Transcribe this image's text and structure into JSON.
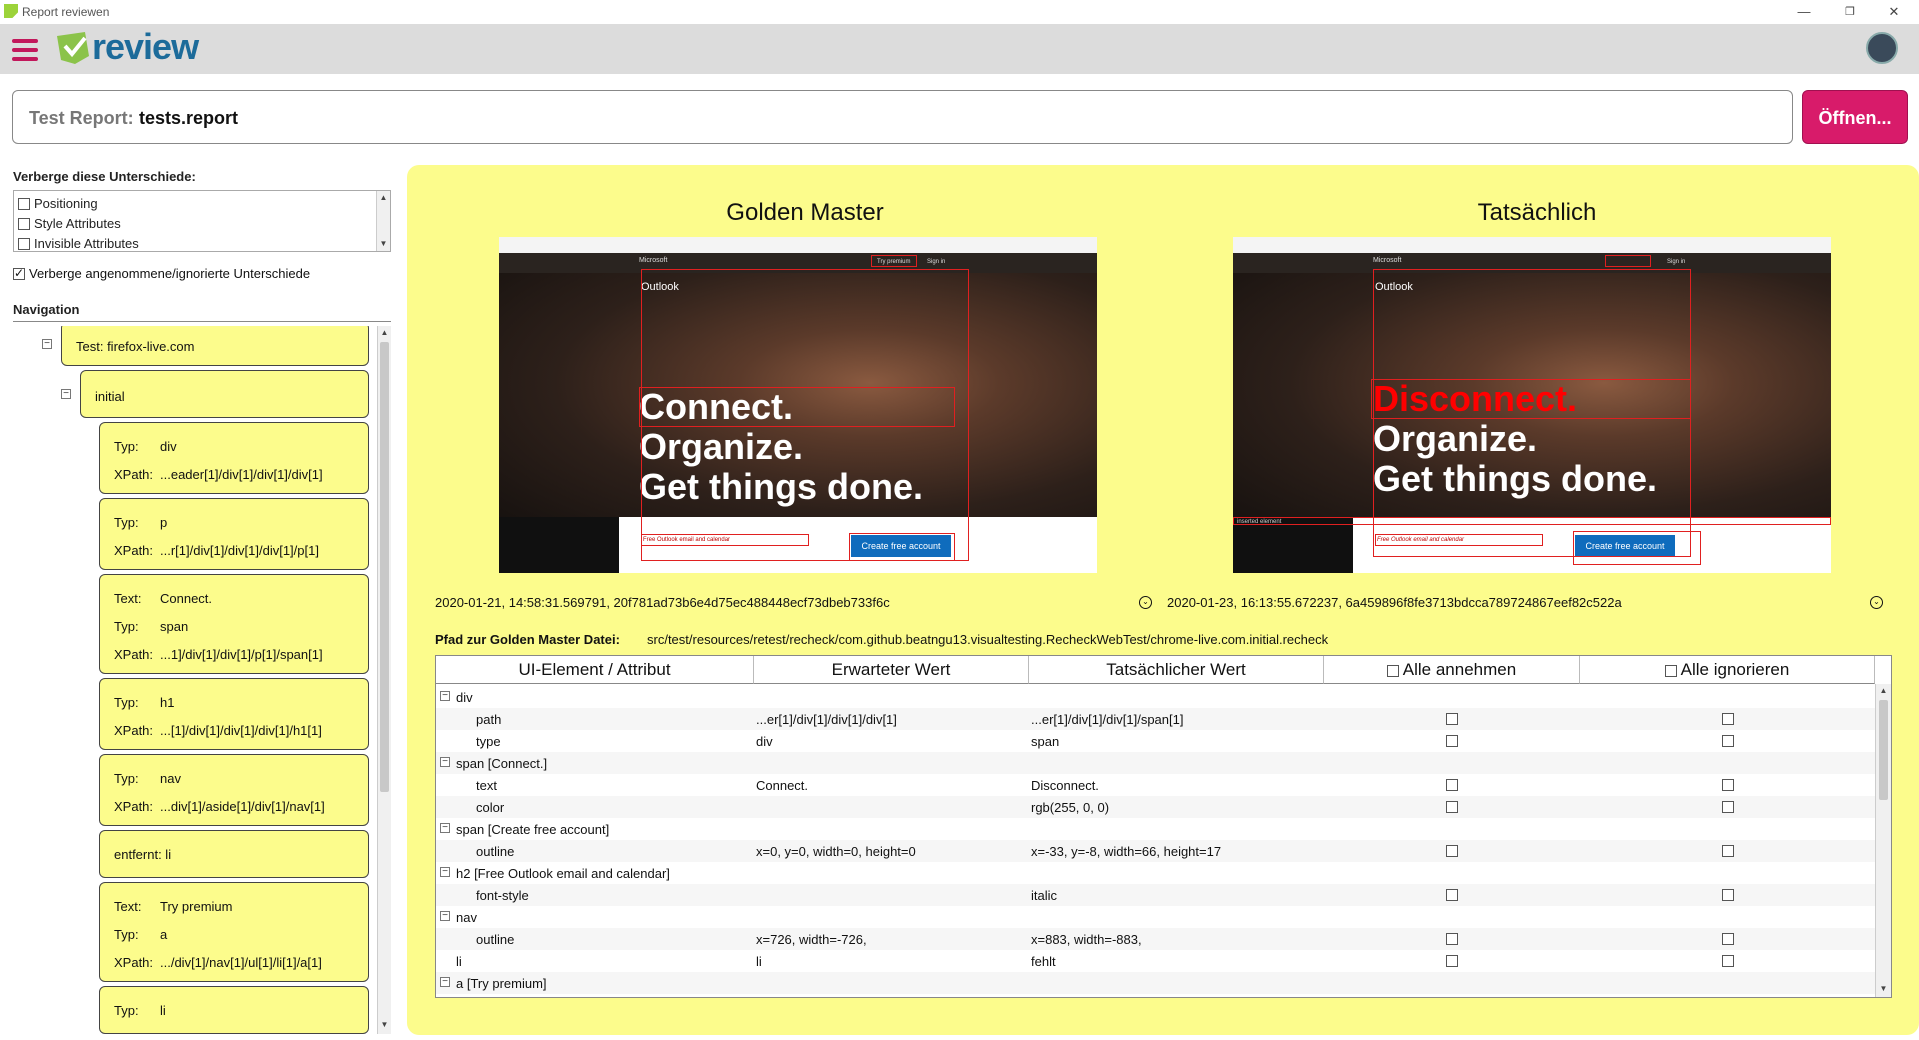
{
  "window": {
    "title": "Report reviewen",
    "minimize": "—",
    "maximize": "❐",
    "close": "✕"
  },
  "header": {
    "logo_text": "review",
    "menu_icon": "hamburger-icon",
    "avatar_icon": "user-avatar-icon"
  },
  "report": {
    "label": "Test Report:",
    "value": "tests.report",
    "open_button": "Öffnen..."
  },
  "filters": {
    "title": "Verberge diese Unterschiede:",
    "items": [
      "Positioning",
      "Style Attributes",
      "Invisible Attributes"
    ],
    "hide_accepted_label": "Verberge angenommene/ignorierte Unterschiede",
    "hide_accepted_checked": true
  },
  "navigation": {
    "title": "Navigation",
    "test_node": "Test: firefox-live.com",
    "state_node": "initial",
    "items": [
      {
        "lines": [
          [
            "Typ:",
            "div"
          ],
          [
            "XPath:",
            "...eader[1]/div[1]/div[1]/div[1]"
          ]
        ]
      },
      {
        "lines": [
          [
            "Typ:",
            "p"
          ],
          [
            "XPath:",
            "...r[1]/div[1]/div[1]/div[1]/p[1]"
          ]
        ]
      },
      {
        "lines": [
          [
            "Text:",
            "Connect."
          ],
          [
            "Typ:",
            "span"
          ],
          [
            "XPath:",
            "...1]/div[1]/div[1]/p[1]/span[1]"
          ]
        ]
      },
      {
        "lines": [
          [
            "Typ:",
            "h1"
          ],
          [
            "XPath:",
            "...[1]/div[1]/div[1]/div[1]/h1[1]"
          ]
        ]
      },
      {
        "lines": [
          [
            "Typ:",
            "nav"
          ],
          [
            "XPath:",
            "...div[1]/aside[1]/div[1]/nav[1]"
          ]
        ]
      },
      {
        "lines": [
          [
            "entfernt: li",
            ""
          ]
        ]
      },
      {
        "lines": [
          [
            "Text:",
            "Try premium"
          ],
          [
            "Typ:",
            "a"
          ],
          [
            "XPath:",
            ".../div[1]/nav[1]/ul[1]/li[1]/a[1]"
          ]
        ]
      },
      {
        "lines": [
          [
            "Typ:",
            "li"
          ]
        ]
      }
    ]
  },
  "comparison": {
    "golden_title": "Golden Master",
    "actual_title": "Tatsächlich",
    "golden_meta": "2020-01-21, 14:58:31.569791, 20f781ad73b6e4d75ec488448ecf73dbeb733f6c",
    "actual_meta": "2020-01-23, 16:13:55.672237, 6a459896f8fe3713bdcca789724867eef82c522a",
    "golden_path_label": "Pfad zur Golden Master Datei:",
    "golden_path": "src/test/resources/retest/recheck/com.github.beatngu13.visualtesting.RecheckWebTest/chrome-live.com.initial.recheck",
    "screenshot": {
      "outlook": "Outlook",
      "ms": "Microsoft",
      "golden_lines": [
        "Connect.",
        "Organize.",
        "Get things done."
      ],
      "actual_lines": [
        "Disconnect.",
        "Organize.",
        "Get things done."
      ],
      "cta": "Create free account",
      "free_text": "Free Outlook email and calendar",
      "try_premium": "Try premium",
      "sign_in": "Sign in",
      "inserted": "inserted element",
      "highlight_color": "#e02020"
    }
  },
  "table": {
    "headers": [
      "UI-Element / Attribut",
      "Erwarteter Wert",
      "Tatsächlicher Wert",
      "Alle annehmen",
      "Alle ignorieren"
    ],
    "rows": [
      {
        "type": "group",
        "name": "div"
      },
      {
        "type": "attr",
        "name": "path",
        "expected": "...er[1]/div[1]/div[1]/div[1]",
        "actual": "...er[1]/div[1]/div[1]/span[1]"
      },
      {
        "type": "attr",
        "name": "type",
        "expected": "div",
        "actual": "span"
      },
      {
        "type": "group",
        "name": "span [Connect.]"
      },
      {
        "type": "attr",
        "name": "text",
        "expected": "Connect.",
        "actual": "Disconnect."
      },
      {
        "type": "attr",
        "name": "color",
        "expected": "",
        "actual": "rgb(255, 0, 0)"
      },
      {
        "type": "group",
        "name": "span [Create free account]"
      },
      {
        "type": "attr",
        "name": "outline",
        "expected": "x=0, y=0, width=0, height=0",
        "actual": "x=-33, y=-8, width=66, height=17"
      },
      {
        "type": "group",
        "name": "h2 [Free Outlook email and calendar]"
      },
      {
        "type": "attr",
        "name": "font-style",
        "expected": "",
        "actual": "italic"
      },
      {
        "type": "group",
        "name": "nav"
      },
      {
        "type": "attr",
        "name": "outline",
        "expected": "x=726, width=-726,",
        "actual": "x=883, width=-883,"
      },
      {
        "type": "leaf",
        "name": "li",
        "expected": "li",
        "actual": "fehlt"
      },
      {
        "type": "group",
        "name": "a [Try premium]"
      }
    ]
  }
}
